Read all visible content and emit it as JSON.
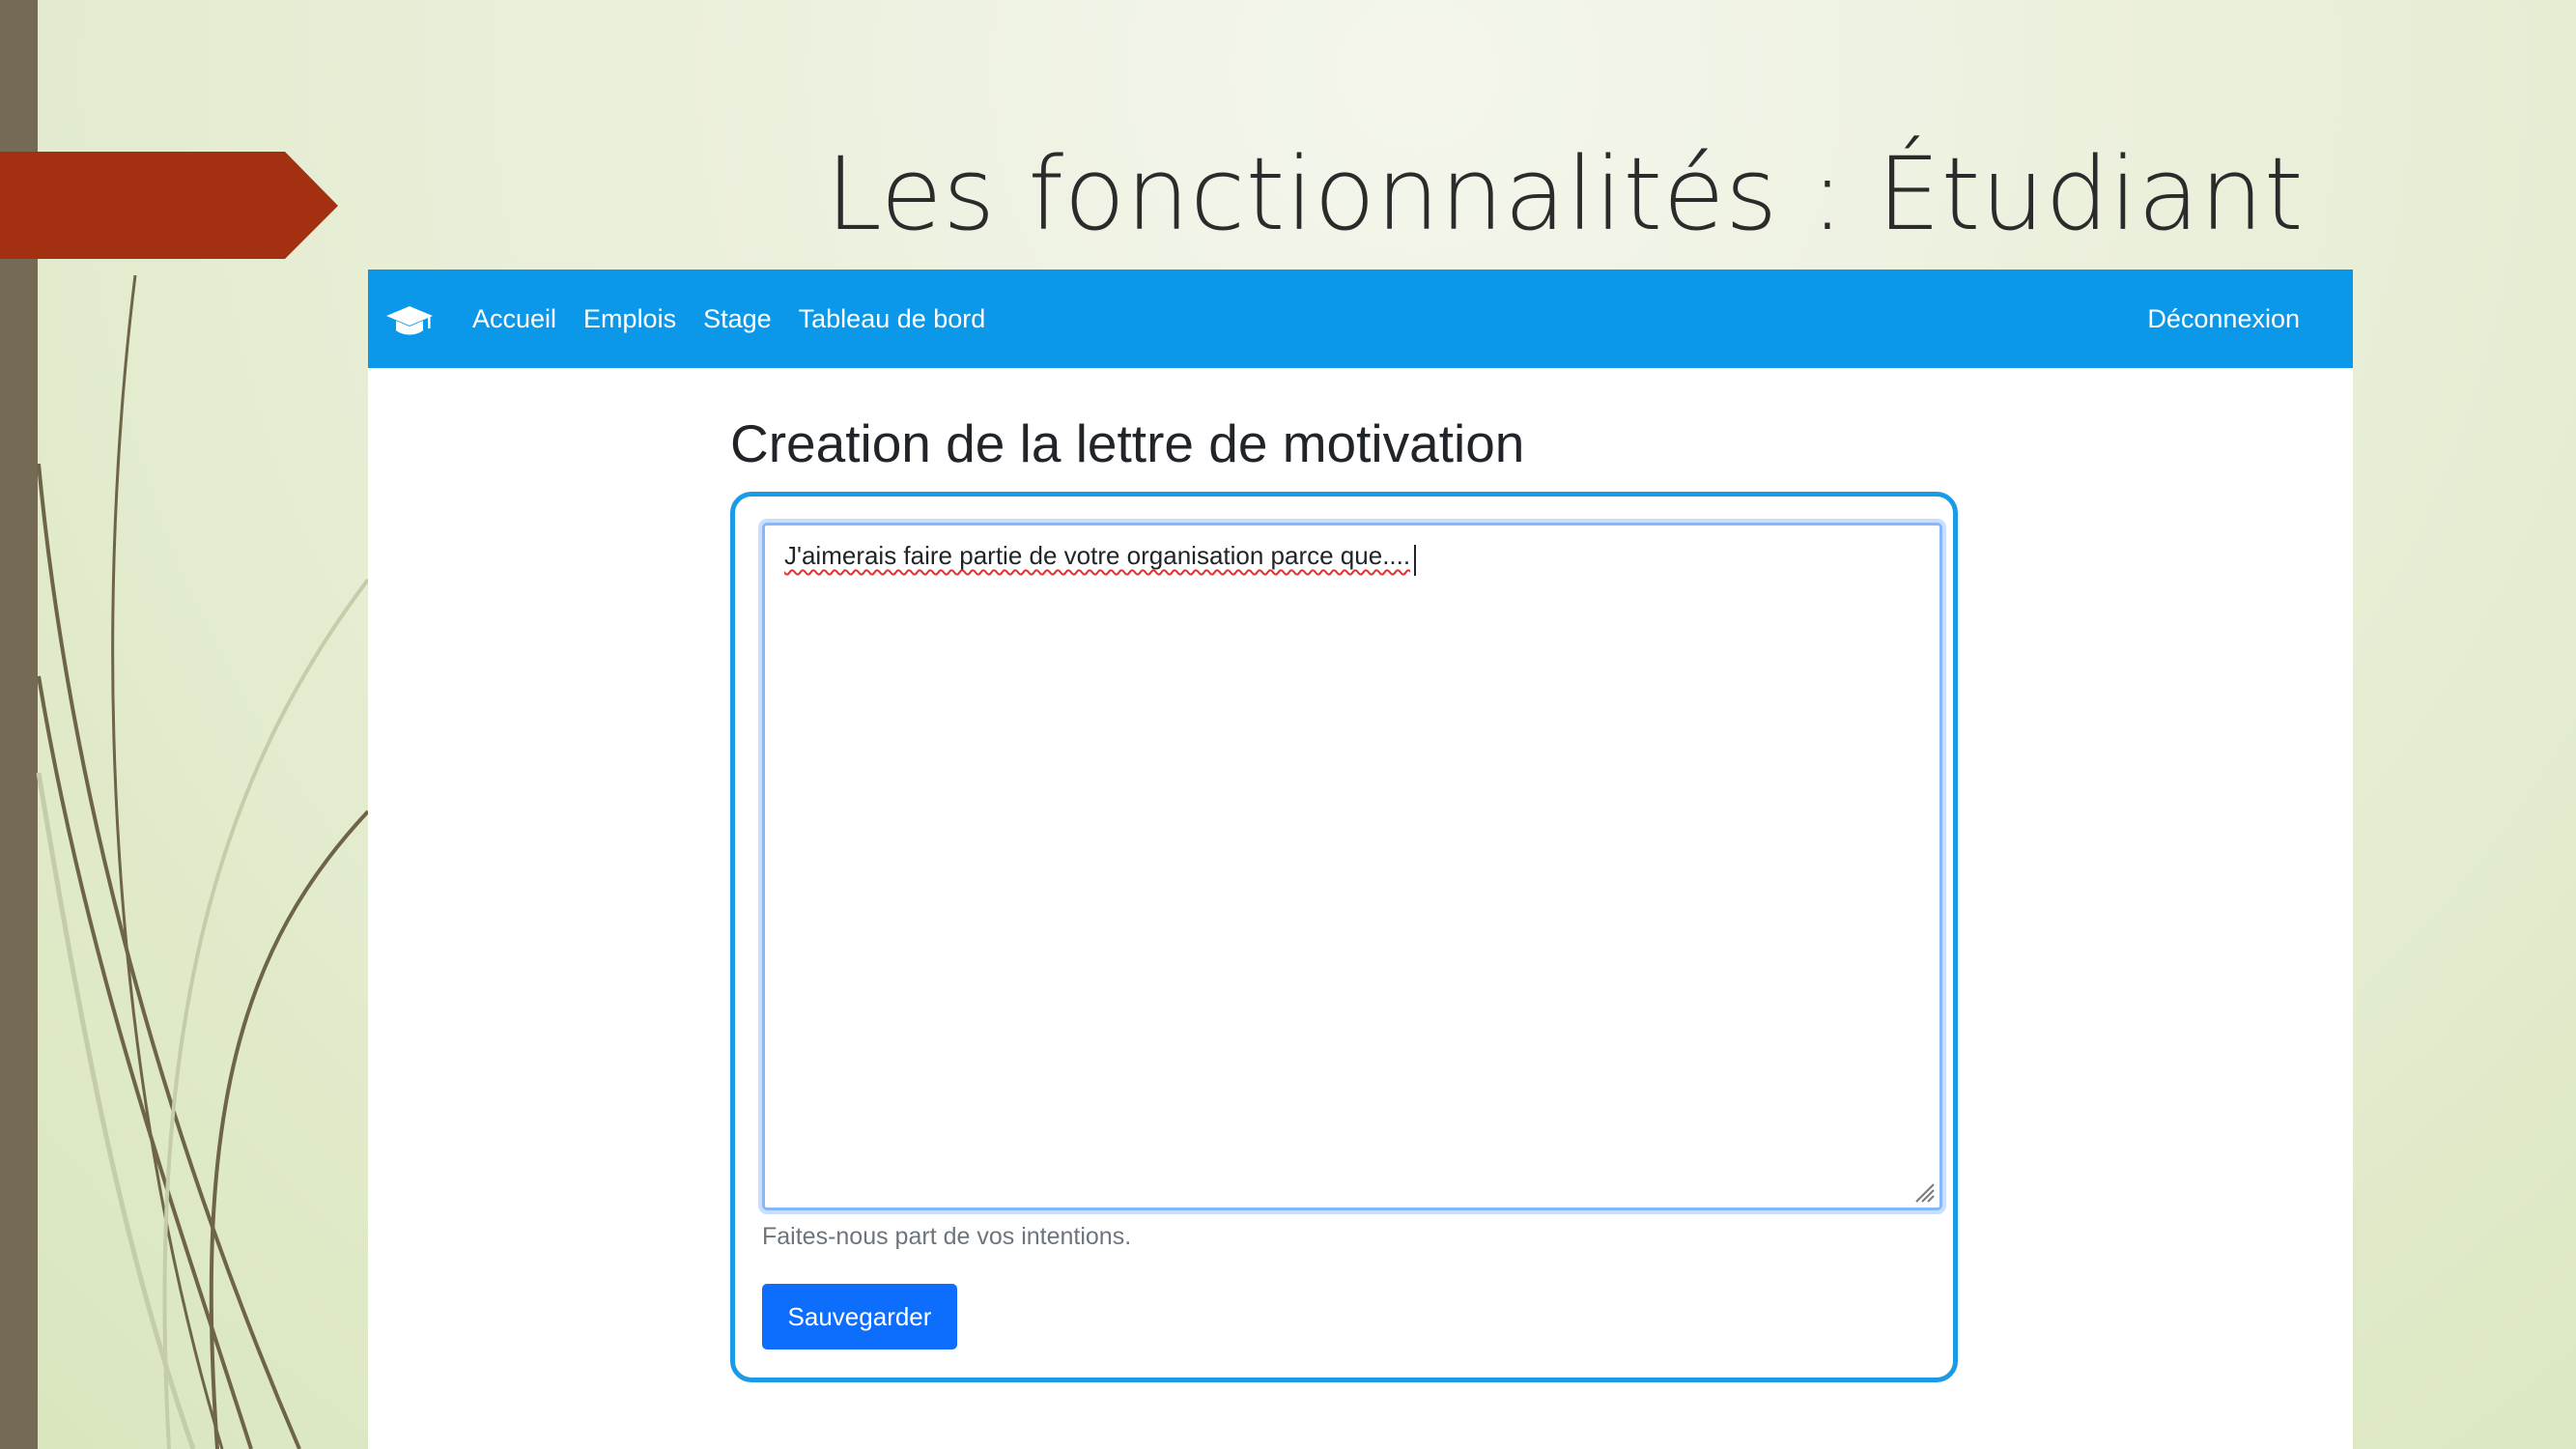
{
  "slide": {
    "title": "Les fonctionnalités : Étudiant"
  },
  "navbar": {
    "brand_icon": "graduation-cap-icon",
    "links": [
      "Accueil",
      "Emplois",
      "Stage",
      "Tableau de bord"
    ],
    "logout": "Déconnexion",
    "color": "#0b98e8"
  },
  "page": {
    "heading": "Creation de la lettre de motivation"
  },
  "form": {
    "textarea_value": "J'aimerais faire partie de votre organisation parce que....",
    "help_text": "Faites-nous part de vos intentions.",
    "save_label": "Sauvegarder",
    "accent": "#0d6efd"
  },
  "colors": {
    "slide_arrow": "#a33111",
    "left_bar": "#756b55"
  }
}
